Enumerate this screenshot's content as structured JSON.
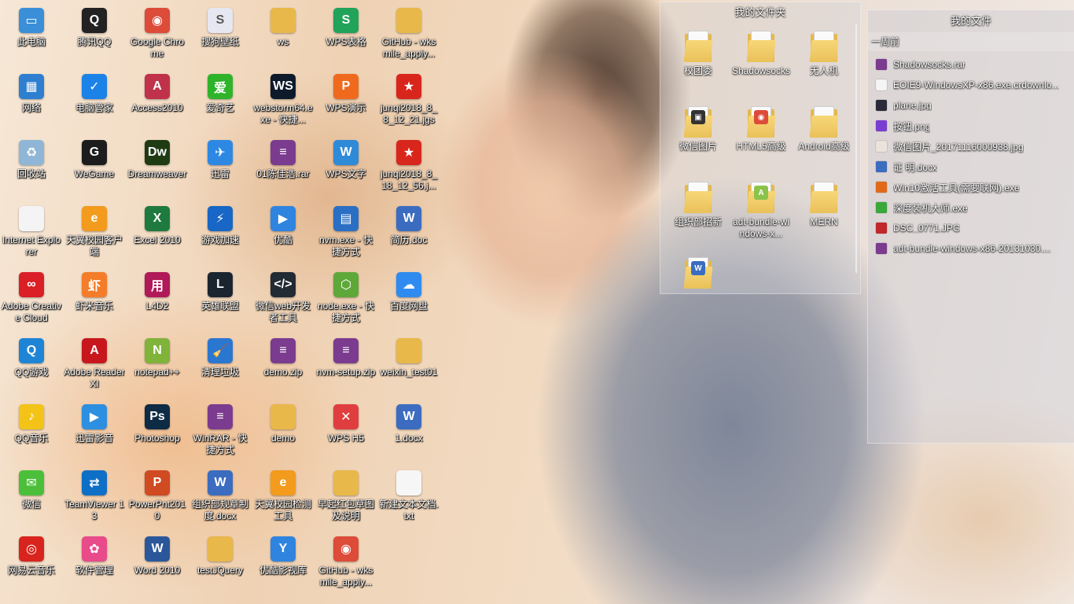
{
  "desktop_icons": [
    {
      "label": "此电脑",
      "icon": "this-pc-icon",
      "color": "#3a8fd8",
      "glyph": "▭"
    },
    {
      "label": "网络",
      "icon": "network-icon",
      "color": "#2f7fd0",
      "glyph": "▦"
    },
    {
      "label": "回收站",
      "icon": "recycle-bin-icon",
      "color": "#8fb6d6",
      "glyph": "♻"
    },
    {
      "label": "Internet Explorer",
      "icon": "file-icon",
      "color": "#f4f4f4",
      "glyph": ""
    },
    {
      "label": "Adobe Creative Cloud",
      "icon": "creative-cloud-icon",
      "color": "#da1f26",
      "glyph": "∞"
    },
    {
      "label": "QQ游戏",
      "icon": "qq-game-icon",
      "color": "#1e84d6",
      "glyph": "Q"
    },
    {
      "label": "QQ音乐",
      "icon": "qq-music-icon",
      "color": "#f3c318",
      "glyph": "♪"
    },
    {
      "label": "微信",
      "icon": "wechat-icon",
      "color": "#4cbf3a",
      "glyph": "✉"
    },
    {
      "label": "网易云音乐",
      "icon": "netease-music-icon",
      "color": "#d8241d",
      "glyph": "◎"
    },
    {
      "label": "腾讯QQ",
      "icon": "qq-icon",
      "color": "#222222",
      "glyph": "Q"
    },
    {
      "label": "电脑管家",
      "icon": "pc-manager-icon",
      "color": "#1b82e8",
      "glyph": "✓"
    },
    {
      "label": "WeGame",
      "icon": "wegame-icon",
      "color": "#1c1c1c",
      "glyph": "G"
    },
    {
      "label": "天翼校园客户端",
      "icon": "tianyi-icon",
      "color": "#f29b1d",
      "glyph": "e"
    },
    {
      "label": "虾米音乐",
      "icon": "xiami-icon",
      "color": "#f57c29",
      "glyph": "虾"
    },
    {
      "label": "Adobe Reader XI",
      "icon": "adobe-reader-icon",
      "color": "#c8161d",
      "glyph": "A"
    },
    {
      "label": "迅雷影音",
      "icon": "xunlei-player-icon",
      "color": "#2d8fe0",
      "glyph": "▶"
    },
    {
      "label": "TeamViewer 13",
      "icon": "teamviewer-icon",
      "color": "#0e6fc7",
      "glyph": "⇄"
    },
    {
      "label": "软件管理",
      "icon": "software-manager-icon",
      "color": "#e84a8a",
      "glyph": "✿"
    },
    {
      "label": "Google Chrome",
      "icon": "chrome-icon",
      "color": "#dd4b39",
      "glyph": "◉"
    },
    {
      "label": "Access2010",
      "icon": "access-icon",
      "color": "#c0314a",
      "glyph": "A"
    },
    {
      "label": "Dreamweaver",
      "icon": "dreamweaver-icon",
      "color": "#1f3b14",
      "glyph": "Dw"
    },
    {
      "label": "Excel 2010",
      "icon": "excel-icon",
      "color": "#1f7a3f",
      "glyph": "X"
    },
    {
      "label": "L4D2",
      "icon": "l4d2-icon",
      "color": "#b11a58",
      "glyph": "用"
    },
    {
      "label": "notepad++",
      "icon": "notepad-plus-icon",
      "color": "#7fb33a",
      "glyph": "N"
    },
    {
      "label": "Photoshop",
      "icon": "photoshop-icon",
      "color": "#0d2b44",
      "glyph": "Ps"
    },
    {
      "label": "PowerPnt2010",
      "icon": "powerpoint-icon",
      "color": "#d04a22",
      "glyph": "P"
    },
    {
      "label": "Word 2010",
      "icon": "word-icon",
      "color": "#2b579a",
      "glyph": "W"
    },
    {
      "label": "搜狗壁纸",
      "icon": "sogou-wallpaper-icon",
      "color": "#e7e7f2",
      "glyph": "S"
    },
    {
      "label": "爱奇艺",
      "icon": "iqiyi-icon",
      "color": "#2fb32a",
      "glyph": "爱"
    },
    {
      "label": "迅雷",
      "icon": "xunlei-icon",
      "color": "#2d88e3",
      "glyph": "✈"
    },
    {
      "label": "游戏加速",
      "icon": "game-accelerator-icon",
      "color": "#1866c5",
      "glyph": "⚡"
    },
    {
      "label": "英雄联盟",
      "icon": "lol-icon",
      "color": "#1b2530",
      "glyph": "L"
    },
    {
      "label": "清理垃圾",
      "icon": "cleanup-icon",
      "color": "#2a77d0",
      "glyph": "🧹"
    },
    {
      "label": "WinRAR - 快捷方式",
      "icon": "winrar-icon",
      "color": "#7b3b8e",
      "glyph": "≡"
    },
    {
      "label": "组织部规章制度.docx",
      "icon": "docx-icon",
      "color": "#3b6cc0",
      "glyph": "W"
    },
    {
      "label": "testJQuery",
      "icon": "folder-icon",
      "color": "#e8b84a",
      "glyph": ""
    },
    {
      "label": "ws",
      "icon": "folder-icon",
      "color": "#e8b84a",
      "glyph": ""
    },
    {
      "label": "webstorm64.exe - 快捷...",
      "icon": "webstorm-icon",
      "color": "#0d1a2b",
      "glyph": "WS"
    },
    {
      "label": "01陈佳浩.rar",
      "icon": "rar-icon",
      "color": "#7b3b8e",
      "glyph": "≡"
    },
    {
      "label": "优酷",
      "icon": "youku-icon",
      "color": "#2f84e0",
      "glyph": "▶"
    },
    {
      "label": "微信web开发者工具",
      "icon": "wechat-devtools-icon",
      "color": "#222a33",
      "glyph": "</>"
    },
    {
      "label": "demo.zip",
      "icon": "zip-icon",
      "color": "#7b3b8e",
      "glyph": "≡"
    },
    {
      "label": "demo",
      "icon": "folder-icon",
      "color": "#e8b84a",
      "glyph": ""
    },
    {
      "label": "天翼校园检测工具",
      "icon": "tianyi-check-icon",
      "color": "#f29b1d",
      "glyph": "e"
    },
    {
      "label": "优酷影视库",
      "icon": "youku-library-icon",
      "color": "#2f84e0",
      "glyph": "Y"
    },
    {
      "label": "WPS表格",
      "icon": "wps-sheet-icon",
      "color": "#21a35a",
      "glyph": "S"
    },
    {
      "label": "WPS演示",
      "icon": "wps-presentation-icon",
      "color": "#f06a1e",
      "glyph": "P"
    },
    {
      "label": "WPS文字",
      "icon": "wps-writer-icon",
      "color": "#2f8ad8",
      "glyph": "W"
    },
    {
      "label": "nvm.exe - 快捷方式",
      "icon": "nvm-icon",
      "color": "#2a6fc4",
      "glyph": "▤"
    },
    {
      "label": "node.exe - 快捷方式",
      "icon": "node-icon",
      "color": "#5ea83a",
      "glyph": "⬡"
    },
    {
      "label": "nvm-setup.zip",
      "icon": "zip-icon",
      "color": "#7b3b8e",
      "glyph": "≡"
    },
    {
      "label": "WPS H5",
      "icon": "wps-h5-icon",
      "color": "#e03e3e",
      "glyph": "✕"
    },
    {
      "label": "早起红包草图及说明",
      "icon": "folder-icon",
      "color": "#e8b84a",
      "glyph": ""
    },
    {
      "label": "GitHub - wksmile_apply...",
      "icon": "chrome-icon",
      "color": "#dd4b39",
      "glyph": "◉"
    },
    {
      "label": "GitHub - wksmile_apply...",
      "icon": "folder-icon",
      "color": "#e8b84a",
      "glyph": ""
    },
    {
      "label": "junqi2018_8_8_12_21.jgs",
      "icon": "junqi-icon",
      "color": "#d9261c",
      "glyph": "★"
    },
    {
      "label": "junqi2018_8_18_12_56.j...",
      "icon": "junqi-icon",
      "color": "#d9261c",
      "glyph": "★"
    },
    {
      "label": "简历.doc",
      "icon": "doc-icon",
      "color": "#3b6cc0",
      "glyph": "W"
    },
    {
      "label": "百度网盘",
      "icon": "baidu-netdisk-icon",
      "color": "#2f8bf0",
      "glyph": "☁"
    },
    {
      "label": "weixin_test01",
      "icon": "folder-icon",
      "color": "#e8b84a",
      "glyph": ""
    },
    {
      "label": "1.docx",
      "icon": "docx-icon",
      "color": "#3b6cc0",
      "glyph": "W"
    },
    {
      "label": "新建文本文档.txt",
      "icon": "txt-icon",
      "color": "#f6f6f6",
      "glyph": ""
    }
  ],
  "fences": {
    "title": "我的文件夹",
    "items": [
      {
        "label": "校团委",
        "inset_color": "",
        "inset_glyph": ""
      },
      {
        "label": "Shadowsocks",
        "inset_color": "",
        "inset_glyph": ""
      },
      {
        "label": "无人机",
        "inset_color": "",
        "inset_glyph": ""
      },
      {
        "label": "微信图片",
        "inset_color": "#333333",
        "inset_glyph": "▣"
      },
      {
        "label": "HTML5高级",
        "inset_color": "#dd4b39",
        "inset_glyph": "◉"
      },
      {
        "label": "Android高级",
        "inset_color": "",
        "inset_glyph": ""
      },
      {
        "label": "组织部招新",
        "inset_color": "",
        "inset_glyph": ""
      },
      {
        "label": "adt-bundle-windows-x...",
        "inset_color": "#8bc34a",
        "inset_glyph": "A"
      },
      {
        "label": "MERN",
        "inset_color": "",
        "inset_glyph": ""
      },
      {
        "label": "",
        "inset_color": "#3b6cc0",
        "inset_glyph": "W"
      }
    ]
  },
  "recent": {
    "title": "我的文件",
    "section": "一周前",
    "files": [
      {
        "name": "Shadowsocks.rar",
        "icon": "rar-icon",
        "color": "#7b3b8e"
      },
      {
        "name": "EOIE9-WindowsXP-x86.exe.crdownlo...",
        "icon": "file-icon",
        "color": "#f4f4f4"
      },
      {
        "name": "plane.jpg",
        "icon": "image-icon",
        "color": "#2a2a3a"
      },
      {
        "name": "按钮.png",
        "icon": "image-icon",
        "color": "#7a3fd0"
      },
      {
        "name": "微信图片_20171116000938.jpg",
        "icon": "image-icon",
        "color": "#e9e3dc"
      },
      {
        "name": "证 明.docx",
        "icon": "docx-icon",
        "color": "#3b6cc0"
      },
      {
        "name": "Win10激活工具(需要联网).exe",
        "icon": "exe-icon",
        "color": "#e06a1a"
      },
      {
        "name": "深度装机大师.exe",
        "icon": "exe-icon",
        "color": "#3aa83a"
      },
      {
        "name": "DSC_0771.JPG",
        "icon": "image-icon",
        "color": "#c0282a"
      },
      {
        "name": "adt-bundle-windows-x86-20131030....",
        "icon": "zip-icon",
        "color": "#7b3b8e"
      }
    ]
  }
}
